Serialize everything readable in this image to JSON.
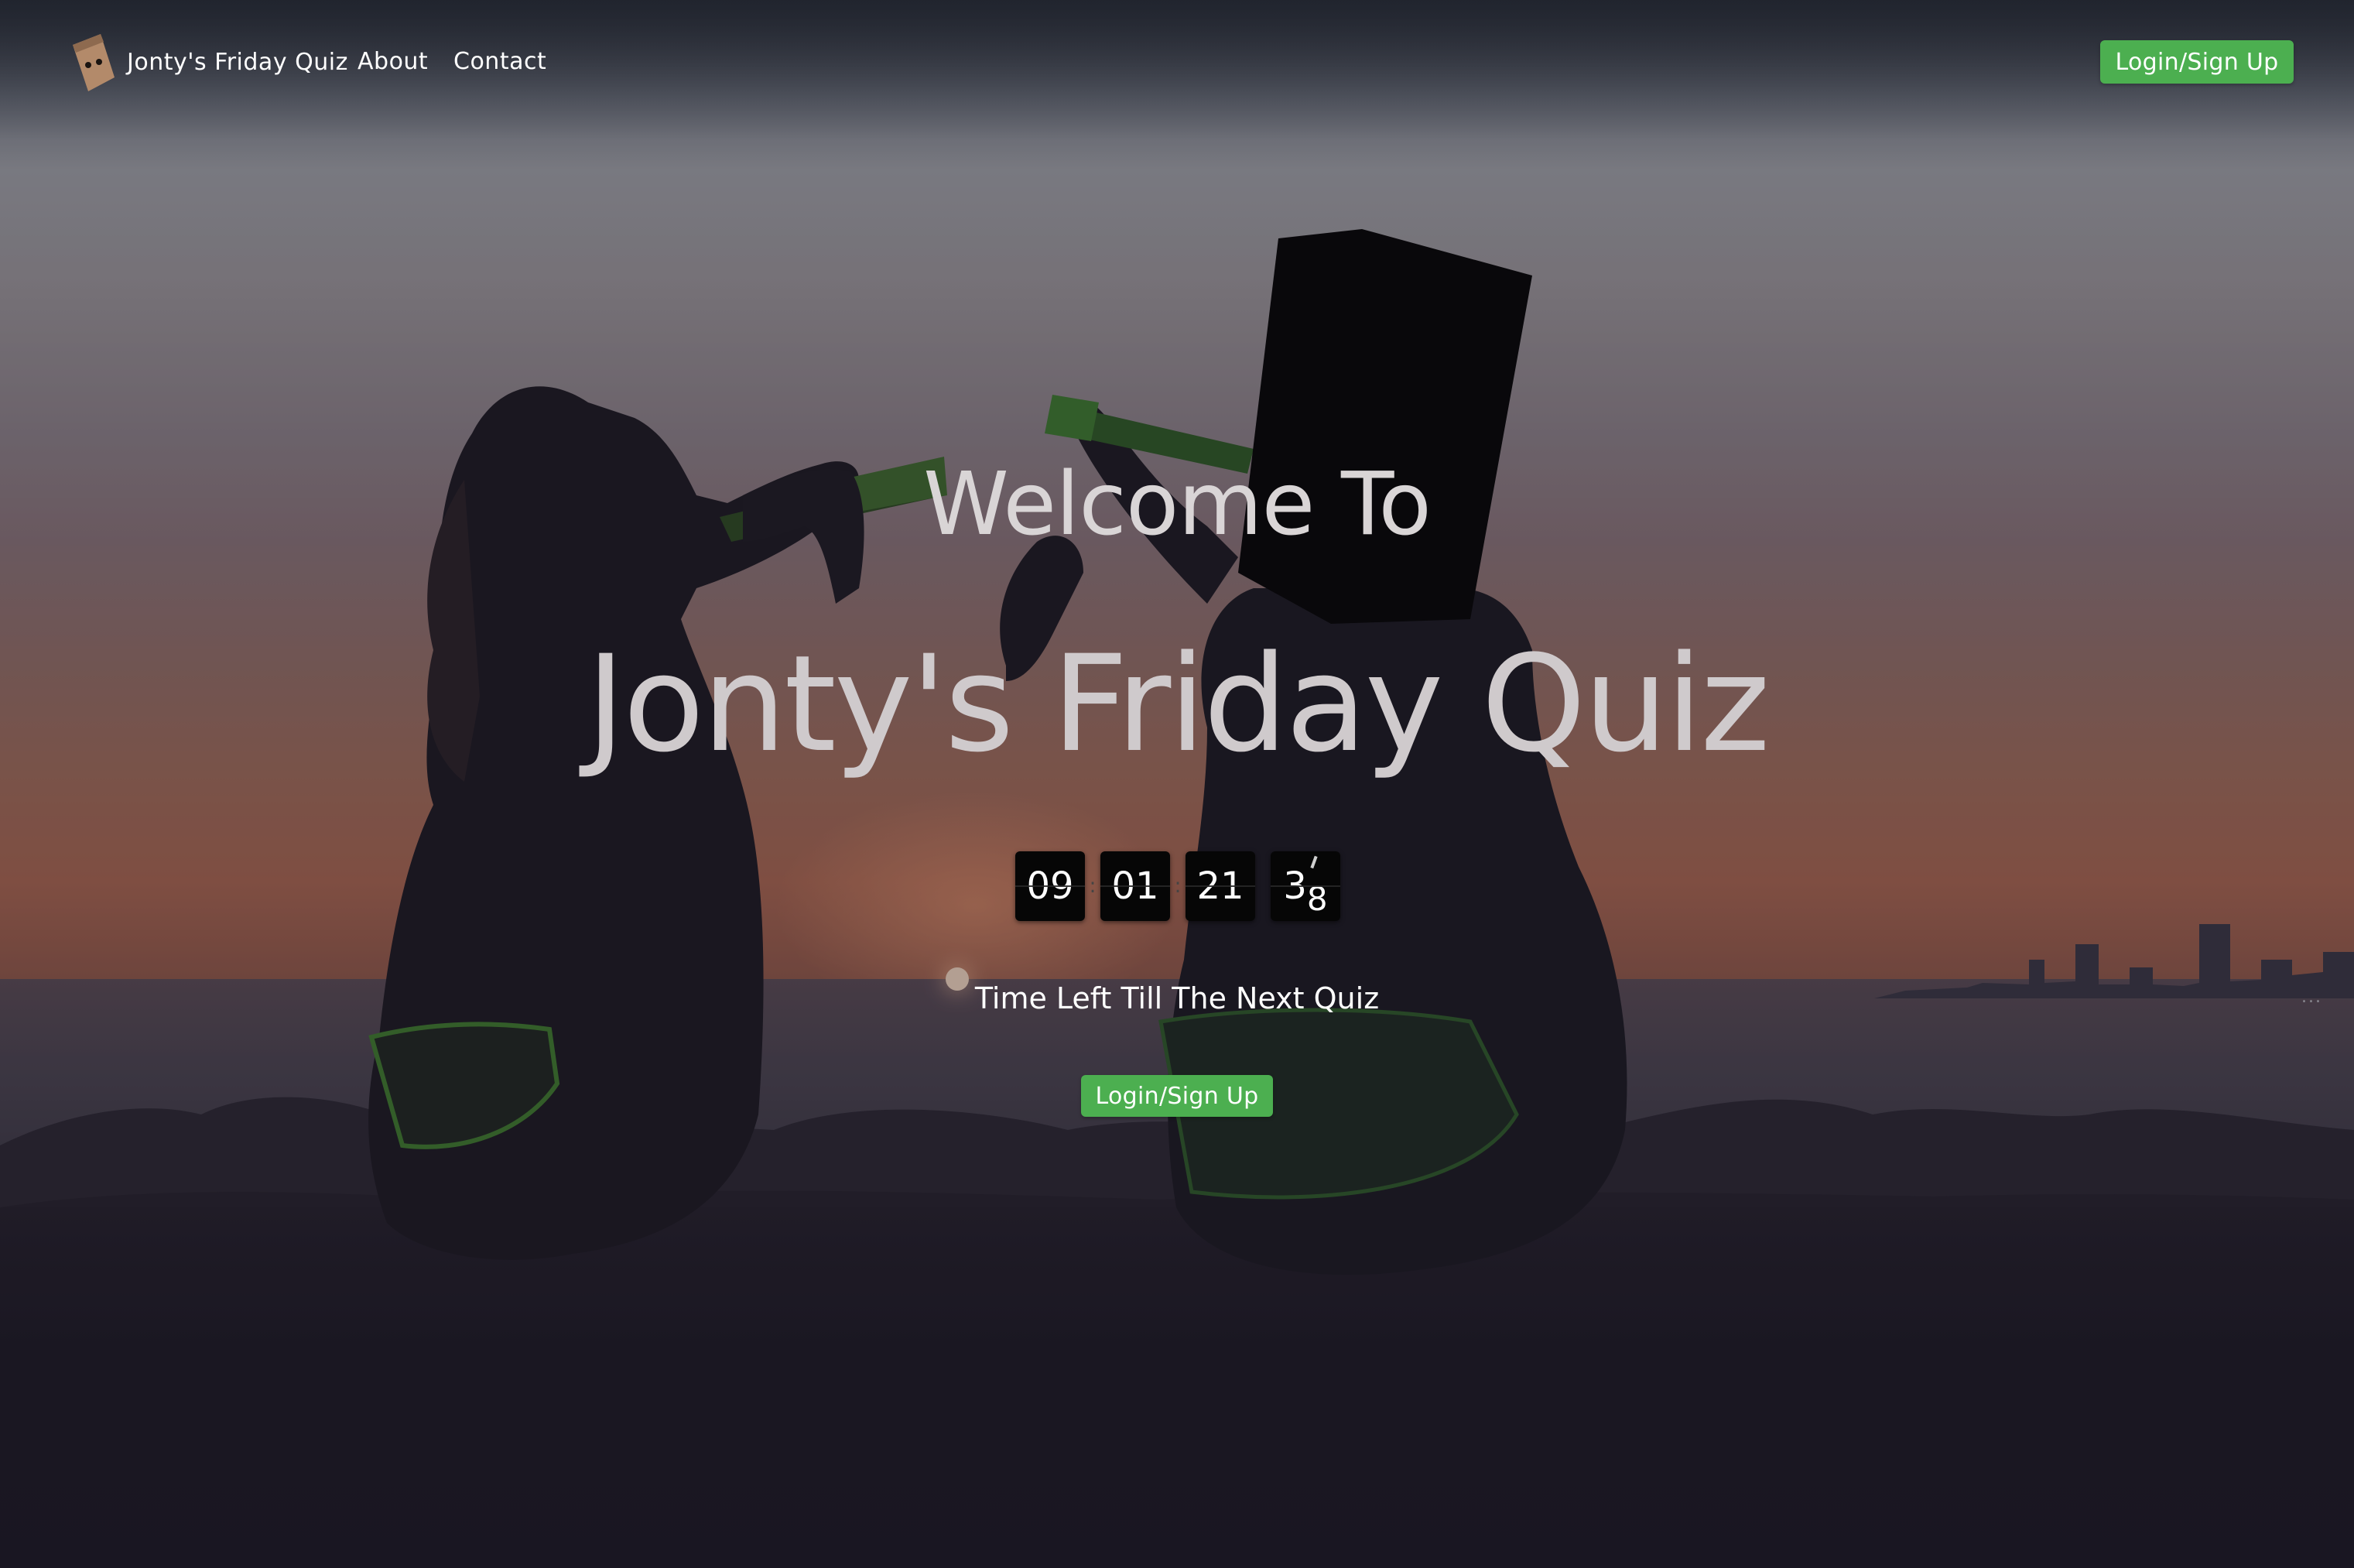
{
  "colors": {
    "accent_green": "#4caf50",
    "timer_box": "#060606",
    "title_text": "#cfcacc"
  },
  "navbar": {
    "logo_icon": "paper-bag-head-icon",
    "brand": "Jonty's Friday Quiz",
    "links": [
      {
        "label": "About"
      },
      {
        "label": "Contact"
      }
    ],
    "login_label": "Login/Sign Up"
  },
  "hero": {
    "welcome": "Welcome To",
    "title": "Jonty's Friday Quiz",
    "countdown": {
      "days": "09",
      "hours": "01",
      "minutes": "21",
      "seconds_tens": "3",
      "seconds_ones": "8",
      "separator": ":"
    },
    "caption": "Time Left Till The Next Quiz",
    "login_label": "Login/Sign Up",
    "more_dots": "..."
  }
}
